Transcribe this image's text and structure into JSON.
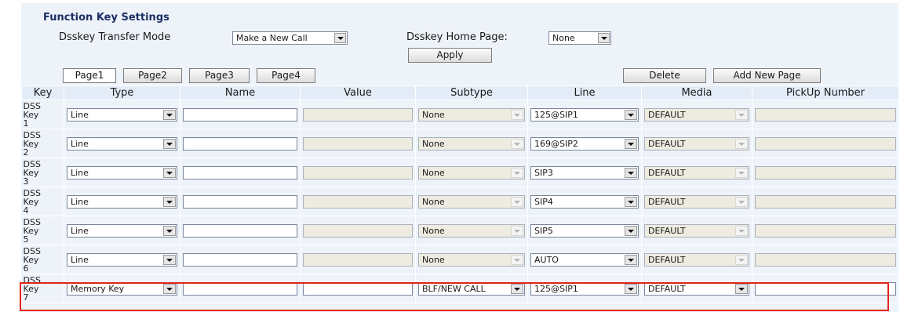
{
  "section_title": "Function Key Settings",
  "transfer_mode": {
    "label": "Dsskey Transfer Mode",
    "value": "Make a New Call"
  },
  "home_page": {
    "label": "Dsskey Home Page:",
    "value": "None"
  },
  "apply_label": "Apply",
  "pages": [
    "Page1",
    "Page2",
    "Page3",
    "Page4"
  ],
  "delete_label": "Delete",
  "add_page_label": "Add New Page",
  "columns": [
    "Key",
    "Type",
    "Name",
    "Value",
    "Subtype",
    "Line",
    "Media",
    "PickUp Number"
  ],
  "rows": [
    {
      "key": [
        "DSS",
        "Key",
        "1"
      ],
      "type": "Line",
      "name": "",
      "value": "",
      "subtype": "None",
      "line": "125@SIP1",
      "media": "DEFAULT",
      "pickup": ""
    },
    {
      "key": [
        "DSS",
        "Key",
        "2"
      ],
      "type": "Line",
      "name": "",
      "value": "",
      "subtype": "None",
      "line": "169@SIP2",
      "media": "DEFAULT",
      "pickup": ""
    },
    {
      "key": [
        "DSS",
        "Key",
        "3"
      ],
      "type": "Line",
      "name": "",
      "value": "",
      "subtype": "None",
      "line": "SIP3",
      "media": "DEFAULT",
      "pickup": ""
    },
    {
      "key": [
        "DSS",
        "Key",
        "4"
      ],
      "type": "Line",
      "name": "",
      "value": "",
      "subtype": "None",
      "line": "SIP4",
      "media": "DEFAULT",
      "pickup": ""
    },
    {
      "key": [
        "DSS",
        "Key",
        "5"
      ],
      "type": "Line",
      "name": "",
      "value": "",
      "subtype": "None",
      "line": "SIP5",
      "media": "DEFAULT",
      "pickup": ""
    },
    {
      "key": [
        "DSS",
        "Key",
        "6"
      ],
      "type": "Line",
      "name": "",
      "value": "",
      "subtype": "None",
      "line": "AUTO",
      "media": "DEFAULT",
      "pickup": ""
    },
    {
      "key": [
        "DSS",
        "Key",
        "7"
      ],
      "type": "Memory Key",
      "name": "",
      "value": "",
      "subtype": "BLF/NEW CALL",
      "line": "125@SIP1",
      "media": "DEFAULT",
      "pickup": ""
    }
  ],
  "colors": {
    "highlight": "#e3231c",
    "panel": "#eef3fa",
    "title": "#1c2f63"
  }
}
